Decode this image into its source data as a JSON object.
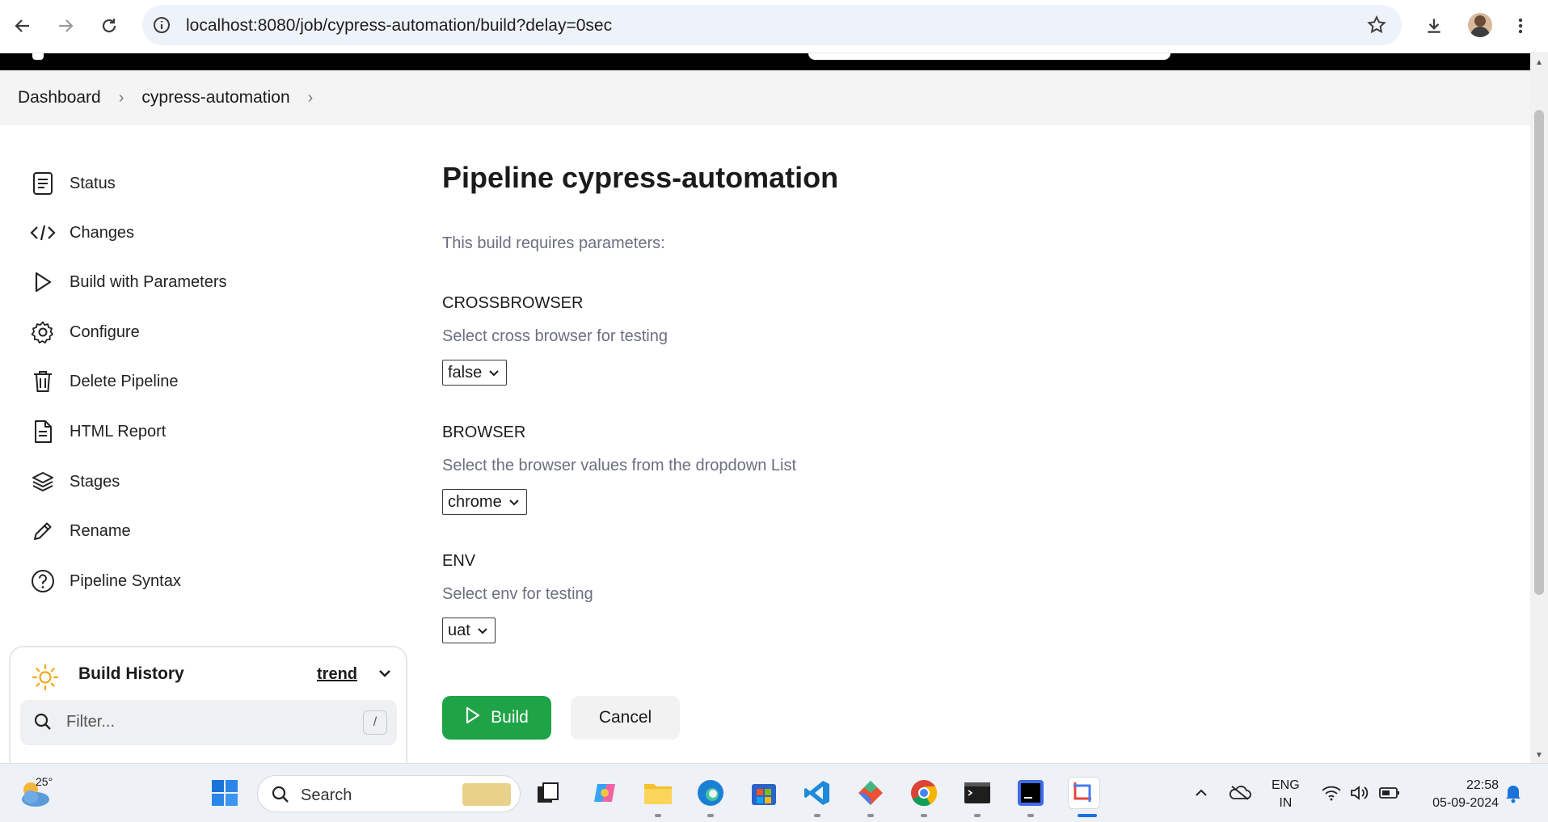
{
  "browser": {
    "url": "localhost:8080/job/cypress-automation/build?delay=0sec"
  },
  "breadcrumb": {
    "items": [
      "Dashboard",
      "cypress-automation"
    ],
    "separator": "›"
  },
  "sidebar": {
    "items": [
      {
        "label": "Status",
        "icon": "status-icon"
      },
      {
        "label": "Changes",
        "icon": "code-icon"
      },
      {
        "label": "Build with Parameters",
        "icon": "play-icon"
      },
      {
        "label": "Configure",
        "icon": "gear-icon"
      },
      {
        "label": "Delete Pipeline",
        "icon": "trash-icon"
      },
      {
        "label": "HTML Report",
        "icon": "document-icon"
      },
      {
        "label": "Stages",
        "icon": "layers-icon"
      },
      {
        "label": "Rename",
        "icon": "pencil-icon"
      },
      {
        "label": "Pipeline Syntax",
        "icon": "help-icon"
      }
    ]
  },
  "build_history": {
    "title": "Build History",
    "trend_label": "trend",
    "filter_placeholder": "Filter...",
    "shortcut_key": "/"
  },
  "main": {
    "title": "Pipeline cypress-automation",
    "intro": "This build requires parameters:",
    "params": [
      {
        "name": "CROSSBROWSER",
        "description": "Select cross browser for testing",
        "value": "false"
      },
      {
        "name": "BROWSER",
        "description": "Select the browser values from the dropdown List",
        "value": "chrome"
      },
      {
        "name": "ENV",
        "description": "Select env for testing",
        "value": "uat"
      }
    ],
    "build_label": "Build",
    "cancel_label": "Cancel"
  },
  "taskbar": {
    "weather_temp": "25°",
    "search_label": "Search",
    "lang_line1": "ENG",
    "lang_line2": "IN",
    "time": "22:58",
    "date": "05-09-2024"
  },
  "colors": {
    "build_button": "#1ea446",
    "breadcrumb_bg": "#f4f4f5",
    "header_bg": "#000000",
    "muted_text": "#6b6f80"
  }
}
